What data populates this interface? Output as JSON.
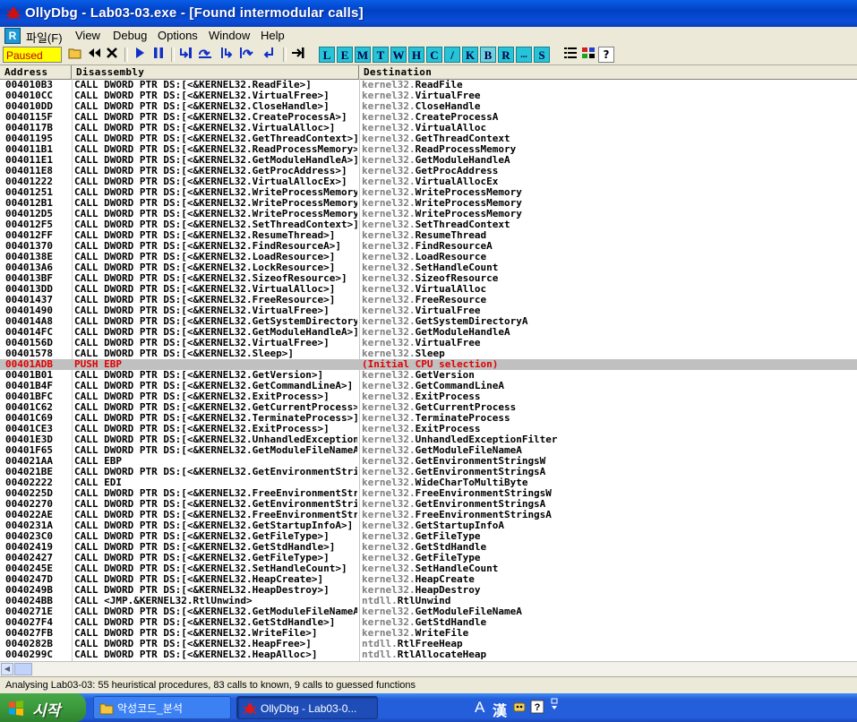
{
  "window": {
    "title": "OllyDbg - Lab03-03.exe - [Found intermodular calls]"
  },
  "menu": {
    "r_icon": "R",
    "items": [
      "파일(F)",
      "View",
      "Debug",
      "Options",
      "Window",
      "Help"
    ]
  },
  "toolbar": {
    "status": "Paused",
    "icons": [
      "open-icon",
      "rewind-icon",
      "close-icon",
      "run-icon",
      "pause-icon",
      "step-into-icon",
      "step-over-icon",
      "trace-into-icon",
      "trace-over-icon",
      "execute-till-return-icon",
      "go-to-icon"
    ],
    "letters": [
      "L",
      "E",
      "M",
      "T",
      "W",
      "H",
      "C",
      "/",
      "K",
      "B",
      "R",
      "...",
      "S"
    ]
  },
  "columns": {
    "address": "Address",
    "disassembly": "Disassembly",
    "destination": "Destination"
  },
  "rows": [
    {
      "addr": "004010B3",
      "dis": "CALL DWORD PTR DS:[<&KERNEL32.ReadFile>]",
      "mod": "kernel32.",
      "fn": "ReadFile"
    },
    {
      "addr": "004010CC",
      "dis": "CALL DWORD PTR DS:[<&KERNEL32.VirtualFree>]",
      "mod": "kernel32.",
      "fn": "VirtualFree"
    },
    {
      "addr": "004010DD",
      "dis": "CALL DWORD PTR DS:[<&KERNEL32.CloseHandle>]",
      "mod": "kernel32.",
      "fn": "CloseHandle"
    },
    {
      "addr": "0040115F",
      "dis": "CALL DWORD PTR DS:[<&KERNEL32.CreateProcessA>]",
      "mod": "kernel32.",
      "fn": "CreateProcessA"
    },
    {
      "addr": "0040117B",
      "dis": "CALL DWORD PTR DS:[<&KERNEL32.VirtualAlloc>]",
      "mod": "kernel32.",
      "fn": "VirtualAlloc"
    },
    {
      "addr": "00401195",
      "dis": "CALL DWORD PTR DS:[<&KERNEL32.GetThreadContext>]",
      "mod": "kernel32.",
      "fn": "GetThreadContext"
    },
    {
      "addr": "004011B1",
      "dis": "CALL DWORD PTR DS:[<&KERNEL32.ReadProcessMemory>]",
      "mod": "kernel32.",
      "fn": "ReadProcessMemory"
    },
    {
      "addr": "004011E1",
      "dis": "CALL DWORD PTR DS:[<&KERNEL32.GetModuleHandleA>]",
      "mod": "kernel32.",
      "fn": "GetModuleHandleA"
    },
    {
      "addr": "004011E8",
      "dis": "CALL DWORD PTR DS:[<&KERNEL32.GetProcAddress>]",
      "mod": "kernel32.",
      "fn": "GetProcAddress"
    },
    {
      "addr": "00401222",
      "dis": "CALL DWORD PTR DS:[<&KERNEL32.VirtualAllocEx>]",
      "mod": "kernel32.",
      "fn": "VirtualAllocEx"
    },
    {
      "addr": "00401251",
      "dis": "CALL DWORD PTR DS:[<&KERNEL32.WriteProcessMemory>]",
      "mod": "kernel32.",
      "fn": "WriteProcessMemory"
    },
    {
      "addr": "004012B1",
      "dis": "CALL DWORD PTR DS:[<&KERNEL32.WriteProcessMemory>]",
      "mod": "kernel32.",
      "fn": "WriteProcessMemory"
    },
    {
      "addr": "004012D5",
      "dis": "CALL DWORD PTR DS:[<&KERNEL32.WriteProcessMemory>]",
      "mod": "kernel32.",
      "fn": "WriteProcessMemory"
    },
    {
      "addr": "004012F5",
      "dis": "CALL DWORD PTR DS:[<&KERNEL32.SetThreadContext>]",
      "mod": "kernel32.",
      "fn": "SetThreadContext"
    },
    {
      "addr": "004012FF",
      "dis": "CALL DWORD PTR DS:[<&KERNEL32.ResumeThread>]",
      "mod": "kernel32.",
      "fn": "ResumeThread"
    },
    {
      "addr": "00401370",
      "dis": "CALL DWORD PTR DS:[<&KERNEL32.FindResourceA>]",
      "mod": "kernel32.",
      "fn": "FindResourceA"
    },
    {
      "addr": "0040138E",
      "dis": "CALL DWORD PTR DS:[<&KERNEL32.LoadResource>]",
      "mod": "kernel32.",
      "fn": "LoadResource"
    },
    {
      "addr": "004013A6",
      "dis": "CALL DWORD PTR DS:[<&KERNEL32.LockResource>]",
      "mod": "kernel32.",
      "fn": "SetHandleCount"
    },
    {
      "addr": "004013BF",
      "dis": "CALL DWORD PTR DS:[<&KERNEL32.SizeofResource>]",
      "mod": "kernel32.",
      "fn": "SizeofResource"
    },
    {
      "addr": "004013DD",
      "dis": "CALL DWORD PTR DS:[<&KERNEL32.VirtualAlloc>]",
      "mod": "kernel32.",
      "fn": "VirtualAlloc"
    },
    {
      "addr": "00401437",
      "dis": "CALL DWORD PTR DS:[<&KERNEL32.FreeResource>]",
      "mod": "kernel32.",
      "fn": "FreeResource"
    },
    {
      "addr": "00401490",
      "dis": "CALL DWORD PTR DS:[<&KERNEL32.VirtualFree>]",
      "mod": "kernel32.",
      "fn": "VirtualFree"
    },
    {
      "addr": "004014A8",
      "dis": "CALL DWORD PTR DS:[<&KERNEL32.GetSystemDirectoryA>]",
      "mod": "kernel32.",
      "fn": "GetSystemDirectoryA"
    },
    {
      "addr": "004014FC",
      "dis": "CALL DWORD PTR DS:[<&KERNEL32.GetModuleHandleA>]",
      "mod": "kernel32.",
      "fn": "GetModuleHandleA"
    },
    {
      "addr": "0040156D",
      "dis": "CALL DWORD PTR DS:[<&KERNEL32.VirtualFree>]",
      "mod": "kernel32.",
      "fn": "VirtualFree"
    },
    {
      "addr": "00401578",
      "dis": "CALL DWORD PTR DS:[<&KERNEL32.Sleep>]",
      "mod": "kernel32.",
      "fn": "Sleep"
    },
    {
      "addr": "00401ADB",
      "dis": "PUSH EBP",
      "mod": "",
      "fn": "(Initial CPU selection)",
      "selected": true
    },
    {
      "addr": "00401B01",
      "dis": "CALL DWORD PTR DS:[<&KERNEL32.GetVersion>]",
      "mod": "kernel32.",
      "fn": "GetVersion"
    },
    {
      "addr": "00401B4F",
      "dis": "CALL DWORD PTR DS:[<&KERNEL32.GetCommandLineA>]",
      "mod": "kernel32.",
      "fn": "GetCommandLineA"
    },
    {
      "addr": "00401BFC",
      "dis": "CALL DWORD PTR DS:[<&KERNEL32.ExitProcess>]",
      "mod": "kernel32.",
      "fn": "ExitProcess"
    },
    {
      "addr": "00401C62",
      "dis": "CALL DWORD PTR DS:[<&KERNEL32.GetCurrentProcess>]",
      "mod": "kernel32.",
      "fn": "GetCurrentProcess"
    },
    {
      "addr": "00401C69",
      "dis": "CALL DWORD PTR DS:[<&KERNEL32.TerminateProcess>]",
      "mod": "kernel32.",
      "fn": "TerminateProcess"
    },
    {
      "addr": "00401CE3",
      "dis": "CALL DWORD PTR DS:[<&KERNEL32.ExitProcess>]",
      "mod": "kernel32.",
      "fn": "ExitProcess"
    },
    {
      "addr": "00401E3D",
      "dis": "CALL DWORD PTR DS:[<&KERNEL32.UnhandledExceptionFilter>]",
      "mod": "kernel32.",
      "fn": "UnhandledExceptionFilter"
    },
    {
      "addr": "00401F65",
      "dis": "CALL DWORD PTR DS:[<&KERNEL32.GetModuleFileNameA>]",
      "mod": "kernel32.",
      "fn": "GetModuleFileNameA"
    },
    {
      "addr": "004021AA",
      "dis": "CALL EBP",
      "mod": "kernel32.",
      "fn": "GetEnvironmentStringsW"
    },
    {
      "addr": "004021BE",
      "dis": "CALL DWORD PTR DS:[<&KERNEL32.GetEnvironmentStrings>]",
      "mod": "kernel32.",
      "fn": "GetEnvironmentStringsA"
    },
    {
      "addr": "00402222",
      "dis": "CALL EDI",
      "mod": "kernel32.",
      "fn": "WideCharToMultiByte"
    },
    {
      "addr": "0040225D",
      "dis": "CALL DWORD PTR DS:[<&KERNEL32.FreeEnvironmentStringsW>]",
      "mod": "kernel32.",
      "fn": "FreeEnvironmentStringsW"
    },
    {
      "addr": "00402270",
      "dis": "CALL DWORD PTR DS:[<&KERNEL32.GetEnvironmentStringsA>]",
      "mod": "kernel32.",
      "fn": "GetEnvironmentStringsA"
    },
    {
      "addr": "004022AE",
      "dis": "CALL DWORD PTR DS:[<&KERNEL32.FreeEnvironmentStringsA>]",
      "mod": "kernel32.",
      "fn": "FreeEnvironmentStringsA"
    },
    {
      "addr": "0040231A",
      "dis": "CALL DWORD PTR DS:[<&KERNEL32.GetStartupInfoA>]",
      "mod": "kernel32.",
      "fn": "GetStartupInfoA"
    },
    {
      "addr": "004023C0",
      "dis": "CALL DWORD PTR DS:[<&KERNEL32.GetFileType>]",
      "mod": "kernel32.",
      "fn": "GetFileType"
    },
    {
      "addr": "00402419",
      "dis": "CALL DWORD PTR DS:[<&KERNEL32.GetStdHandle>]",
      "mod": "kernel32.",
      "fn": "GetStdHandle"
    },
    {
      "addr": "00402427",
      "dis": "CALL DWORD PTR DS:[<&KERNEL32.GetFileType>]",
      "mod": "kernel32.",
      "fn": "GetFileType"
    },
    {
      "addr": "0040245E",
      "dis": "CALL DWORD PTR DS:[<&KERNEL32.SetHandleCount>]",
      "mod": "kernel32.",
      "fn": "SetHandleCount"
    },
    {
      "addr": "0040247D",
      "dis": "CALL DWORD PTR DS:[<&KERNEL32.HeapCreate>]",
      "mod": "kernel32.",
      "fn": "HeapCreate"
    },
    {
      "addr": "0040249B",
      "dis": "CALL DWORD PTR DS:[<&KERNEL32.HeapDestroy>]",
      "mod": "kernel32.",
      "fn": "HeapDestroy"
    },
    {
      "addr": "004024BB",
      "dis": "CALL <JMP.&KERNEL32.RtlUnwind>",
      "mod": "ntdll.",
      "fn": "RtlUnwind"
    },
    {
      "addr": "0040271E",
      "dis": "CALL DWORD PTR DS:[<&KERNEL32.GetModuleFileNameA>]",
      "mod": "kernel32.",
      "fn": "GetModuleFileNameA"
    },
    {
      "addr": "004027F4",
      "dis": "CALL DWORD PTR DS:[<&KERNEL32.GetStdHandle>]",
      "mod": "kernel32.",
      "fn": "GetStdHandle"
    },
    {
      "addr": "004027FB",
      "dis": "CALL DWORD PTR DS:[<&KERNEL32.WriteFile>]",
      "mod": "kernel32.",
      "fn": "WriteFile"
    },
    {
      "addr": "0040282B",
      "dis": "CALL DWORD PTR DS:[<&KERNEL32.HeapFree>]",
      "mod": "ntdll.",
      "fn": "RtlFreeHeap"
    },
    {
      "addr": "0040299C",
      "dis": "CALL DWORD PTR DS:[<&KERNEL32.HeapAlloc>]",
      "mod": "ntdll.",
      "fn": "RtlAllocateHeap"
    }
  ],
  "status_line": "Analysing Lab03-03: 55 heuristical procedures, 83 calls to known, 9 calls to guessed functions",
  "taskbar": {
    "start_label": "시작",
    "tasks": [
      {
        "label": "악성코드_분석",
        "icon": "folder-icon"
      },
      {
        "label": "OllyDbg - Lab03-0...",
        "icon": "ollydbg-icon"
      }
    ],
    "tray": {
      "ime_mode": "A",
      "hanja": "漢"
    }
  }
}
